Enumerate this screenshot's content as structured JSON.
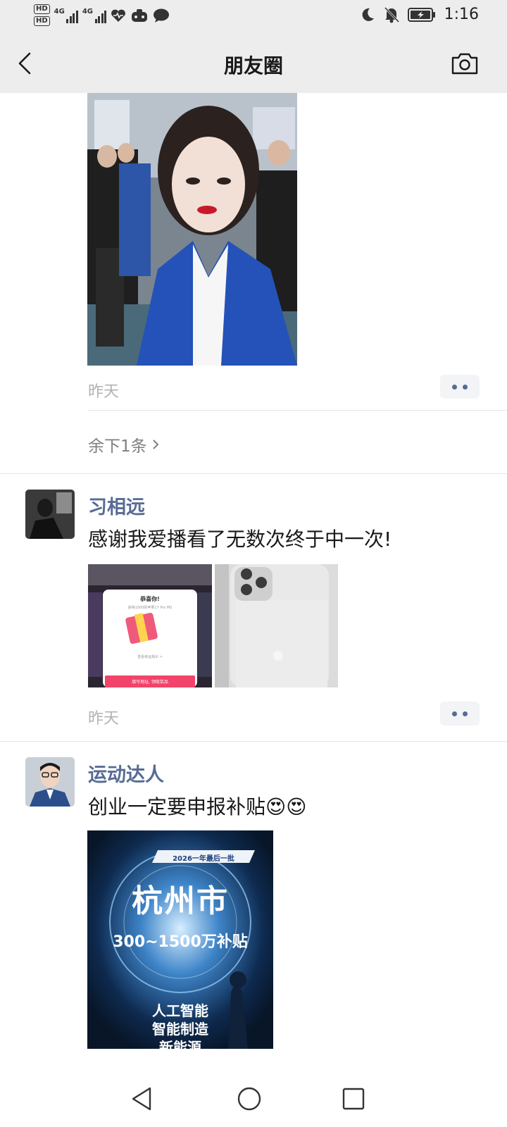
{
  "status_bar": {
    "hd_badges": [
      "HD",
      "HD"
    ],
    "network_labels": [
      "4G",
      "4G"
    ],
    "time": "1:16",
    "icons": [
      "heart-pulse-icon",
      "game-controller-icon",
      "chat-bubble-icon",
      "moon-icon",
      "bell-muted-icon",
      "battery-charging-icon"
    ]
  },
  "nav": {
    "title": "朋友圈",
    "back_icon": "back-arrow-icon",
    "camera_icon": "camera-icon"
  },
  "posts": [
    {
      "photo": "selfie-photo",
      "time": "昨天",
      "remaining": "余下1条"
    },
    {
      "author": "习相远",
      "text": "感谢我爱播看了无数次终于中一次!",
      "images": [
        {
          "name": "prize-screenshot",
          "header": "恭喜你!",
          "subtext": "获得1000的苹果17 Pro MS",
          "note": "查看幸运揭示 >",
          "button": "填写地址, 领取奖品"
        },
        {
          "name": "iphone-photo"
        }
      ],
      "time": "昨天"
    },
    {
      "author": "运动达人",
      "text": "创业一定要申报补贴😍😍",
      "poster": {
        "top_tag": "2026一年最后一批",
        "city": "杭州市",
        "amount": "300~1500万补贴",
        "lines": [
          "人工智能",
          "智能制造",
          "新能源"
        ]
      }
    }
  ],
  "colors": {
    "link_blue": "#576b95",
    "time_gray": "#b2b2b2",
    "nav_bg": "#ededed",
    "prize_button": "#f2436a"
  }
}
